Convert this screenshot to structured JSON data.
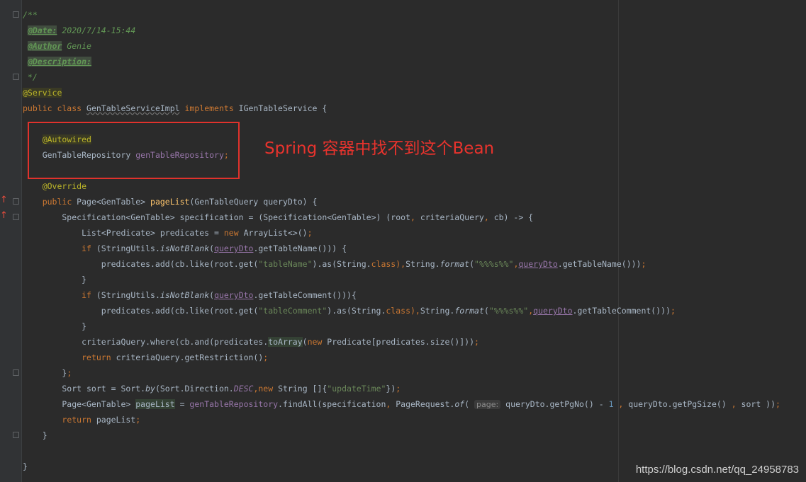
{
  "editor": {
    "lines": [
      [
        {
          "t": "/**",
          "c": "cm"
        }
      ],
      [
        {
          "t": " "
        },
        {
          "t": "@Date:",
          "c": "tag"
        },
        {
          "t": " 2020/7/14-15:44",
          "c": "cm"
        }
      ],
      [
        {
          "t": " "
        },
        {
          "t": "@Author",
          "c": "tag"
        },
        {
          "t": " Genie",
          "c": "cm"
        }
      ],
      [
        {
          "t": " "
        },
        {
          "t": "@Description:",
          "c": "tag"
        }
      ],
      [
        {
          "t": " */",
          "c": "cm"
        }
      ],
      [
        {
          "t": "@Service",
          "c": "ann-hl"
        }
      ],
      [
        {
          "t": "public class ",
          "c": "kw"
        },
        {
          "t": "GenTableServiceImpl",
          "c": "uw"
        },
        {
          "t": " implements ",
          "c": "kw"
        },
        {
          "t": "IGenTableService {"
        }
      ],
      [
        {
          "t": ""
        }
      ],
      [
        {
          "t": "    "
        },
        {
          "t": "@Autowired",
          "c": "ann-hl"
        }
      ],
      [
        {
          "t": "    GenTableRepository "
        },
        {
          "t": "genTableRepository",
          "c": "fld"
        },
        {
          "t": ";",
          "c": "kw"
        }
      ],
      [
        {
          "t": ""
        }
      ],
      [
        {
          "t": "    "
        },
        {
          "t": "@Override",
          "c": "ann"
        }
      ],
      [
        {
          "t": "    "
        },
        {
          "t": "public ",
          "c": "kw"
        },
        {
          "t": "Page<GenTable> "
        },
        {
          "t": "pageList",
          "c": "fn"
        },
        {
          "t": "(GenTableQuery queryDto) {"
        }
      ],
      [
        {
          "t": "        Specification<GenTable> specification = (Specification<GenTable>) (root"
        },
        {
          "t": ", ",
          "c": "kw"
        },
        {
          "t": "criteriaQuery"
        },
        {
          "t": ", ",
          "c": "kw"
        },
        {
          "t": "cb) -> {"
        }
      ],
      [
        {
          "t": "            List<Predicate> predicates = "
        },
        {
          "t": "new ",
          "c": "kw"
        },
        {
          "t": "ArrayList<>()"
        },
        {
          "t": ";",
          "c": "kw"
        }
      ],
      [
        {
          "t": "            "
        },
        {
          "t": "if ",
          "c": "kw"
        },
        {
          "t": "(StringUtils."
        },
        {
          "t": "isNotBlank",
          "c": "it"
        },
        {
          "t": "("
        },
        {
          "t": "queryDto",
          "c": "fld ul"
        },
        {
          "t": ".getTableName())) {"
        }
      ],
      [
        {
          "t": "                predicates.add(cb.like(root.get("
        },
        {
          "t": "\"tableName\"",
          "c": "str"
        },
        {
          "t": ").as(String."
        },
        {
          "t": "class",
          "c": "kw"
        },
        {
          "t": "),",
          "c": "kw"
        },
        {
          "t": "String."
        },
        {
          "t": "format",
          "c": "it"
        },
        {
          "t": "("
        },
        {
          "t": "\"%%%s%%\"",
          "c": "str"
        },
        {
          "t": ",",
          "c": "kw"
        },
        {
          "t": "queryDto",
          "c": "fld ul"
        },
        {
          "t": ".getTableName()))"
        },
        {
          "t": ";",
          "c": "kw"
        }
      ],
      [
        {
          "t": "            }"
        }
      ],
      [
        {
          "t": "            "
        },
        {
          "t": "if ",
          "c": "kw"
        },
        {
          "t": "(StringUtils."
        },
        {
          "t": "isNotBlank",
          "c": "it"
        },
        {
          "t": "("
        },
        {
          "t": "queryDto",
          "c": "fld ul"
        },
        {
          "t": ".getTableComment())){"
        }
      ],
      [
        {
          "t": "                predicates.add(cb.like(root.get("
        },
        {
          "t": "\"tableComment\"",
          "c": "str"
        },
        {
          "t": ").as(String."
        },
        {
          "t": "class",
          "c": "kw"
        },
        {
          "t": "),",
          "c": "kw"
        },
        {
          "t": "String."
        },
        {
          "t": "format",
          "c": "it"
        },
        {
          "t": "("
        },
        {
          "t": "\"%%%s%%\"",
          "c": "str"
        },
        {
          "t": ",",
          "c": "kw"
        },
        {
          "t": "queryDto",
          "c": "fld ul"
        },
        {
          "t": ".getTableComment()))"
        },
        {
          "t": ";",
          "c": "kw"
        }
      ],
      [
        {
          "t": "            }"
        }
      ],
      [
        {
          "t": "            criteriaQuery.where(cb.and(predicates."
        },
        {
          "t": "toArray",
          "c": "sel-bg"
        },
        {
          "t": "("
        },
        {
          "t": "new ",
          "c": "kw"
        },
        {
          "t": "Predicate[predicates.size()]))"
        },
        {
          "t": ";",
          "c": "kw"
        }
      ],
      [
        {
          "t": "            "
        },
        {
          "t": "return ",
          "c": "kw"
        },
        {
          "t": "criteriaQuery.getRestriction()"
        },
        {
          "t": ";",
          "c": "kw"
        }
      ],
      [
        {
          "t": "        }"
        },
        {
          "t": ";",
          "c": "kw"
        }
      ],
      [
        {
          "t": "        Sort sort = Sort."
        },
        {
          "t": "by",
          "c": "it"
        },
        {
          "t": "(Sort.Direction."
        },
        {
          "t": "DESC",
          "c": "fld it"
        },
        {
          "t": ",",
          "c": "kw"
        },
        {
          "t": "new ",
          "c": "kw"
        },
        {
          "t": "String []{"
        },
        {
          "t": "\"updateTime\"",
          "c": "str"
        },
        {
          "t": "})"
        },
        {
          "t": ";",
          "c": "kw"
        }
      ],
      [
        {
          "t": "        Page<GenTable> "
        },
        {
          "t": "pageList",
          "c": "sel-bg"
        },
        {
          "t": " = "
        },
        {
          "t": "genTableRepository",
          "c": "fld"
        },
        {
          "t": ".findAll(specification"
        },
        {
          "t": ", ",
          "c": "kw"
        },
        {
          "t": "PageRequest."
        },
        {
          "t": "of",
          "c": "it"
        },
        {
          "t": "( "
        },
        {
          "t": "page:",
          "c": "hint"
        },
        {
          "t": " queryDto.getPgNo() - "
        },
        {
          "t": "1",
          "c": "num"
        },
        {
          "t": " , ",
          "c": "kw"
        },
        {
          "t": "queryDto.getPgSize() "
        },
        {
          "t": ", ",
          "c": "kw"
        },
        {
          "t": "sort ))"
        },
        {
          "t": ";",
          "c": "kw"
        }
      ],
      [
        {
          "t": "        "
        },
        {
          "t": "return ",
          "c": "kw"
        },
        {
          "t": "pageList"
        },
        {
          "t": ";",
          "c": "kw"
        }
      ],
      [
        {
          "t": "    }"
        }
      ],
      [
        {
          "t": ""
        }
      ],
      [
        {
          "t": "}"
        }
      ]
    ]
  },
  "annotation": {
    "note": "Spring 容器中找不到这个Bean"
  },
  "watermark": "https://blog.csdn.net/qq_24958783",
  "colors": {
    "background": "#2b2b2b",
    "keyword": "#cc7832",
    "annotation": "#bbb529",
    "field": "#9876aa",
    "method": "#ffc66d",
    "string": "#6a8759",
    "comment": "#629755",
    "highlight_box": "#e0322c"
  }
}
